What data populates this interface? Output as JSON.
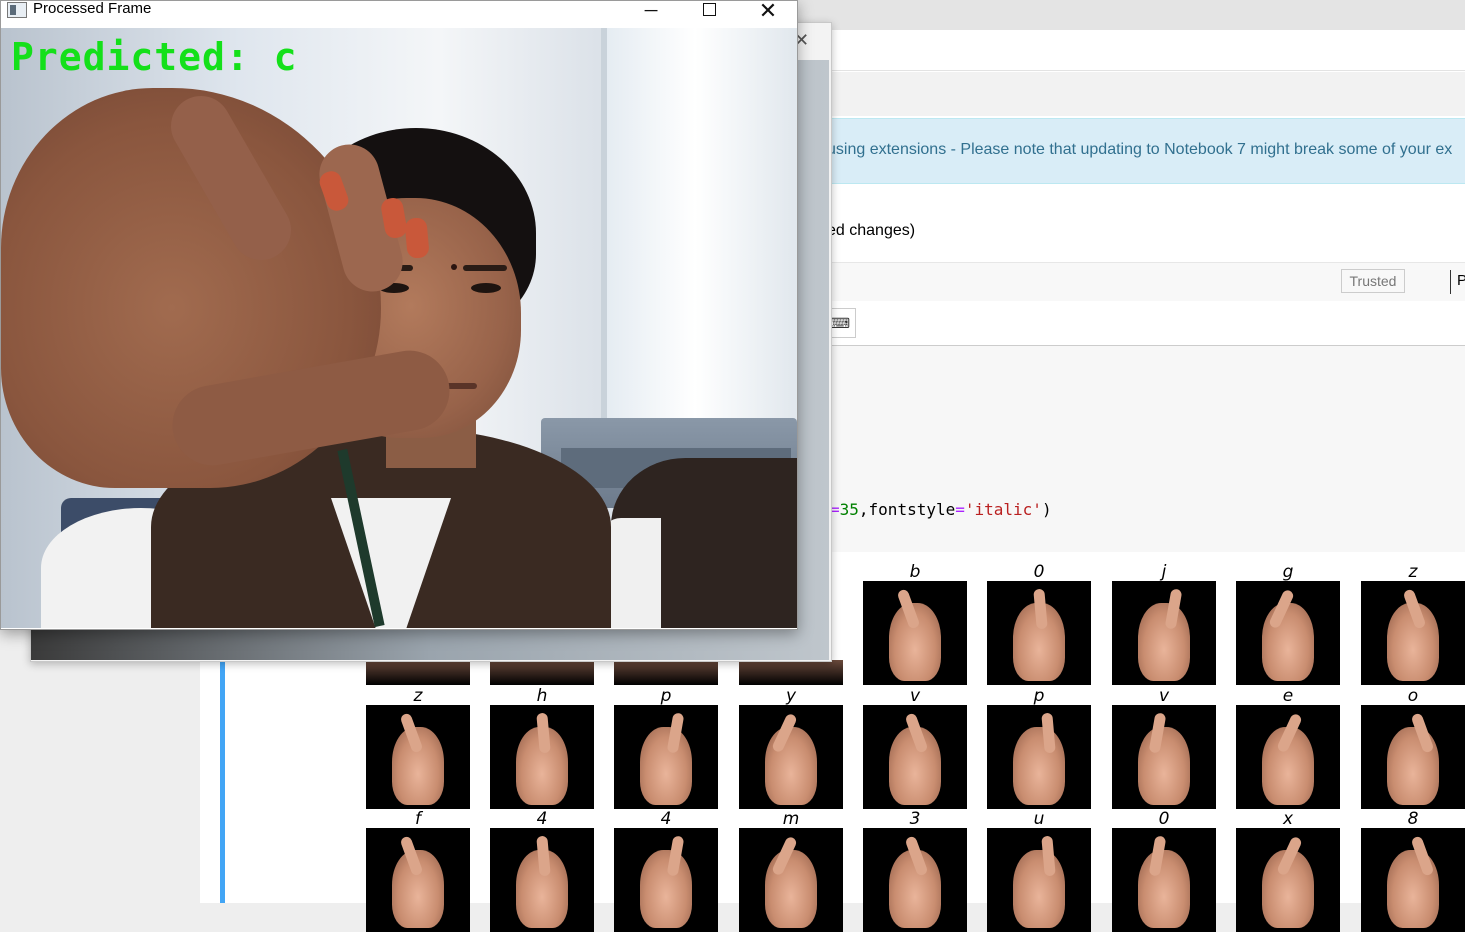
{
  "processed_window": {
    "title": "Processed Frame",
    "prediction_text": "Predicted: c",
    "controls": {
      "minimize_glyph": "─",
      "close_glyph": "✕"
    }
  },
  "background_window": {
    "close_glyph": "✕"
  },
  "notebook": {
    "alert_text": "using extensions - Please note that updating to Notebook 7 might break some of your ex",
    "save_status": "ed changes)",
    "trusted_label": "Trusted",
    "kernel_label": "P",
    "keyboard_glyph": "⌨",
    "code": {
      "prefix": "=",
      "number": "35",
      "mid": ",fontstyle",
      "eq": "=",
      "string": "'italic'",
      "suffix": ")"
    }
  },
  "sign_grid": {
    "row1_labels": [
      "b",
      "0",
      "j",
      "g",
      "z"
    ],
    "row2_labels": [
      "z",
      "h",
      "p",
      "y",
      "v",
      "p",
      "v",
      "e",
      "o"
    ],
    "row3_labels": [
      "f",
      "4",
      "4",
      "m",
      "3",
      "u",
      "0",
      "x",
      "8"
    ]
  },
  "colors": {
    "prediction_green": "#14e01a",
    "alert_bg": "#d9edf7",
    "alert_text": "#31708f",
    "cell_bar": "#42a5f5"
  }
}
